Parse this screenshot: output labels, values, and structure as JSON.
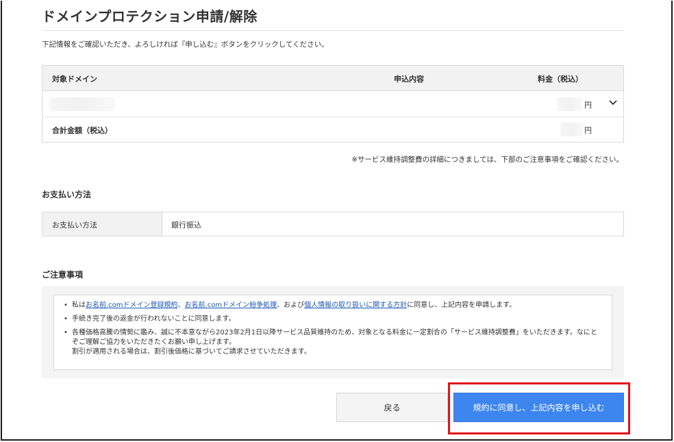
{
  "page": {
    "title": "ドメインプロテクション申請/解除",
    "intro": "下記情報をご確認いただき、よろしければ『申し込む』ボタンをクリックしてください。"
  },
  "order_table": {
    "headers": {
      "domain": "対象ドメイン",
      "content": "申込内容",
      "fee": "料金（税込）"
    },
    "domain_row": {
      "domain": "",
      "content": "",
      "fee_unit": "円"
    },
    "total_row": {
      "label": "合計金額（税込）",
      "fee_unit": "円"
    }
  },
  "service_note": "※サービス維持調整費の詳細につきましては、下部のご注意事項をご確認ください。",
  "payment": {
    "section_title": "お支払い方法",
    "label": "お支払い方法",
    "value": "銀行振込"
  },
  "notes": {
    "section_title": "ご注意事項",
    "item1": {
      "prefix": "私は",
      "link1": "お名前.comドメイン登録規約",
      "sep1": "、",
      "link2": "お名前.comドメイン紛争処理",
      "sep2": "、および",
      "link3": "個人情報の取り扱いに関する方針",
      "suffix": "に同意し、上記内容を申請します。"
    },
    "item2": "手続き完了後の返金が行われないことに同意します。",
    "item3_line1": "各種価格高騰の情勢に鑑み、誠に不本意ながら2023年2月1日以降サービス品質維持のため、対象となる料金に一定割合の「サービス維持調整費」をいただきます。なにとぞご理解ご協力をいただきたくお願い申し上げます。",
    "item3_line2": "割引が適用される場合は、割引後価格に基づいてご請求させていただきます。"
  },
  "buttons": {
    "back": "戻る",
    "apply": "規約に同意し、上記内容を申し込む"
  },
  "colors": {
    "primary": "#3d86ef",
    "link": "#1a57b3",
    "highlight": "#e2121a"
  }
}
